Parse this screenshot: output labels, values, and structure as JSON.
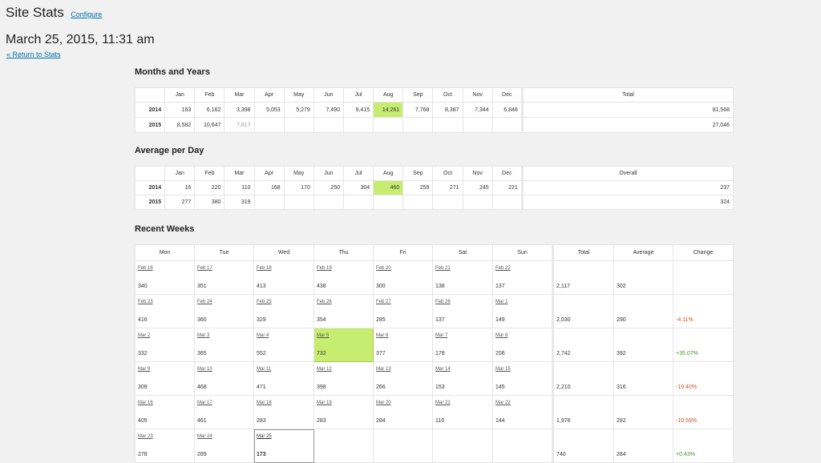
{
  "header": {
    "title": "Site Stats",
    "configure_label": "Configure",
    "date_title": "March 25, 2015, 11:31 am",
    "return_label": "« Return to Stats"
  },
  "colors": {
    "highlight": "#c6ed6f",
    "link": "#0073aa",
    "negative": "#d54e21",
    "positive": "#3a9a2a"
  },
  "months_years": {
    "title": "Months and Years",
    "months": [
      "Jan",
      "Feb",
      "Mar",
      "Apr",
      "May",
      "Jun",
      "Jul",
      "Aug",
      "Sep",
      "Oct",
      "Nov",
      "Dec"
    ],
    "total_label": "Total",
    "rows": [
      {
        "year": "2014",
        "values": [
          "163",
          "6,162",
          "3,398",
          "5,053",
          "5,279",
          "7,490",
          "9,415",
          "14,261",
          "7,768",
          "8,387",
          "7,344",
          "6,848"
        ],
        "total": "81,568"
      },
      {
        "year": "2015",
        "values": [
          "8,582",
          "10,647",
          "7,817",
          "",
          "",
          "",
          "",
          "",
          "",
          "",
          "",
          ""
        ],
        "total": "27,046"
      }
    ]
  },
  "avg_per_day": {
    "title": "Average per Day",
    "months": [
      "Jan",
      "Feb",
      "Mar",
      "Apr",
      "May",
      "Jun",
      "Jul",
      "Aug",
      "Sep",
      "Oct",
      "Nov",
      "Dec"
    ],
    "total_label": "Overall",
    "rows": [
      {
        "year": "2014",
        "values": [
          "16",
          "220",
          "110",
          "168",
          "170",
          "250",
          "304",
          "460",
          "259",
          "271",
          "245",
          "221"
        ],
        "total": "237"
      },
      {
        "year": "2015",
        "values": [
          "277",
          "380",
          "319",
          "",
          "",
          "",
          "",
          "",
          "",
          "",
          "",
          ""
        ],
        "total": "324"
      }
    ]
  },
  "recent_weeks": {
    "title": "Recent Weeks",
    "days": [
      "Mon",
      "Tue",
      "Wed",
      "Thu",
      "Fri",
      "Sat",
      "Sun"
    ],
    "summary_headers": [
      "Total",
      "Average",
      "Change"
    ],
    "weeks": [
      {
        "dates": [
          "Feb 16",
          "Feb 17",
          "Feb 18",
          "Feb 19",
          "Feb 20",
          "Feb 21",
          "Feb 22"
        ],
        "values": [
          "340",
          "351",
          "413",
          "438",
          "300",
          "138",
          "137"
        ],
        "total": "2,117",
        "average": "302",
        "change": ""
      },
      {
        "dates": [
          "Feb 23",
          "Feb 24",
          "Feb 25",
          "Feb 26",
          "Feb 27",
          "Feb 28",
          "Mar 1"
        ],
        "values": [
          "416",
          "360",
          "329",
          "354",
          "285",
          "137",
          "149"
        ],
        "total": "2,030",
        "average": "290",
        "change": "-4.11%"
      },
      {
        "dates": [
          "Mar 2",
          "Mar 3",
          "Mar 4",
          "Mar 5",
          "Mar 6",
          "Mar 7",
          "Mar 8"
        ],
        "values": [
          "332",
          "365",
          "552",
          "732",
          "377",
          "178",
          "206"
        ],
        "total": "2,742",
        "average": "392",
        "change": "+35.07%"
      },
      {
        "dates": [
          "Mar 9",
          "Mar 10",
          "Mar 11",
          "Mar 12",
          "Mar 13",
          "Mar 14",
          "Mar 15"
        ],
        "values": [
          "309",
          "468",
          "471",
          "398",
          "266",
          "153",
          "145"
        ],
        "total": "2,210",
        "average": "316",
        "change": "-19.40%"
      },
      {
        "dates": [
          "Mar 16",
          "Mar 17",
          "Mar 18",
          "Mar 19",
          "Mar 20",
          "Mar 21",
          "Mar 22"
        ],
        "values": [
          "405",
          "461",
          "283",
          "283",
          "284",
          "116",
          "144"
        ],
        "total": "1,976",
        "average": "282",
        "change": "-10.59%"
      },
      {
        "dates": [
          "Mar 23",
          "Mar 24",
          "Mar 25",
          "",
          "",
          "",
          ""
        ],
        "values": [
          "278",
          "289",
          "173",
          "",
          "",
          "",
          ""
        ],
        "total": "740",
        "average": "284",
        "change": "+0.43%"
      }
    ]
  }
}
